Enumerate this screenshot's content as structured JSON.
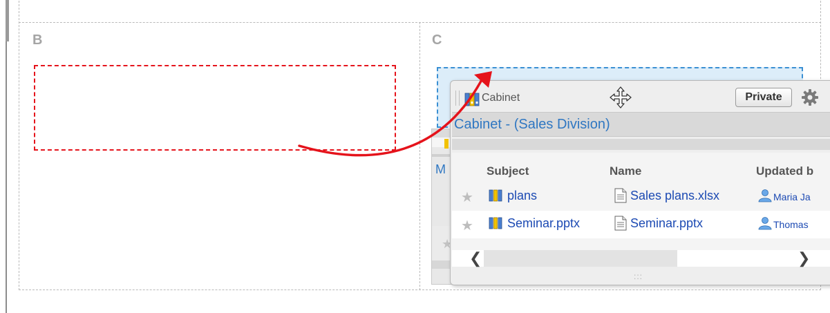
{
  "columns": {
    "b_label": "B",
    "c_label": "C"
  },
  "background_portlet": {
    "partial_title": "M"
  },
  "portlet": {
    "title": "Cabinet",
    "private_button_label": "Private",
    "cabinet_heading": "Cabinet - (Sales Division)",
    "table": {
      "headers": [
        "Subject",
        "Name",
        "Updated b"
      ],
      "rows": [
        {
          "subject": "plans",
          "name": "Sales plans.xlsx",
          "updated_by": "Maria Ja"
        },
        {
          "subject": "Seminar.pptx",
          "name": "Seminar.pptx",
          "updated_by": "Thomas"
        }
      ]
    },
    "scroll_left_glyph": "❮",
    "scroll_right_glyph": "❯",
    "resize_grip_glyph": ":::"
  },
  "icons": {
    "cabinet": "cabinet-icon",
    "move": "move-cursor-icon",
    "gear": "gear-icon",
    "star": "star-icon",
    "folder": "folder-icon",
    "document": "document-icon",
    "user": "user-icon"
  },
  "colors": {
    "source_zone_border": "#e5131b",
    "target_zone_border": "#3a8fd3",
    "target_zone_fill": "#dcedf9",
    "arrow": "#e5131b",
    "link": "#1c4ab3",
    "heading_link": "#2f77c2"
  }
}
